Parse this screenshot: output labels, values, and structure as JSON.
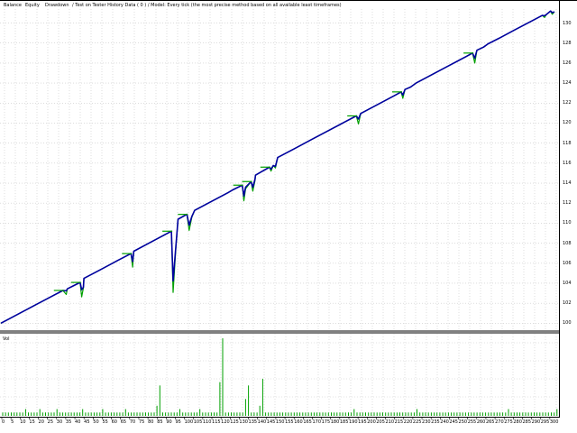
{
  "header": {
    "caption_parts": [
      "Balance",
      "Equity",
      "Drawdown"
    ],
    "caption_colors": [
      "#0000c0",
      "#00a000",
      "#000000"
    ],
    "caption_rest": "/ Test on Tester History Data ( 0 ) / Model: Every tick (the most precise method based on all available least timeframes)"
  },
  "volume": {
    "label": "Vol"
  },
  "chart_data": [
    {
      "type": "line",
      "title": "",
      "xlabel": "",
      "ylabel": "",
      "x": [
        0,
        3,
        6,
        9,
        11.2,
        11.8,
        12,
        13,
        14.3,
        14.6,
        14.9,
        15,
        18,
        21,
        23.5,
        23.8,
        24,
        27,
        30.8,
        31.1,
        31.6,
        32,
        33.6,
        34,
        34.5,
        35,
        38,
        41,
        42,
        43.6,
        43.9,
        44.2,
        45.2,
        45.5,
        45.9,
        46,
        47,
        47.9,
        48.5,
        48.8,
        49.2,
        49.6,
        50,
        53,
        56,
        59,
        62,
        64.2,
        64.6,
        65,
        68,
        71,
        72.3,
        72.6,
        73,
        74,
        75,
        78,
        81,
        84,
        85.2,
        85.6,
        86,
        87.2,
        88,
        90,
        93,
        96,
        97.8,
        98.2,
        98.6,
        99.3,
        99.6,
        100
      ],
      "series": [
        {
          "name": "Balance",
          "color": "#0000a0",
          "values": [
            1000,
            1022,
            1044,
            1066,
            1082,
            1081,
            1086,
            1093,
            1102,
            1084,
            1090,
            1112,
            1134,
            1156,
            1174,
            1154,
            1180,
            1202,
            1230,
            1106,
            1190,
            1260,
            1272,
            1245,
            1267,
            1282,
            1304,
            1326,
            1334,
            1345,
            1318,
            1340,
            1354,
            1340,
            1359,
            1370,
            1378,
            1385,
            1390,
            1385,
            1394,
            1392,
            1414,
            1436,
            1458,
            1480,
            1502,
            1518,
            1510,
            1524,
            1546,
            1568,
            1578,
            1570,
            1584,
            1590,
            1600,
            1622,
            1644,
            1666,
            1675,
            1662,
            1682,
            1690,
            1698,
            1712,
            1734,
            1756,
            1769,
            1768,
            1772,
            1780,
            1776,
            1778
          ]
        },
        {
          "name": "Equity",
          "color": "#00a000",
          "values": [
            1000,
            1022,
            1044,
            1066,
            1082,
            1072,
            1086,
            1093,
            1102,
            1066,
            1088,
            1112,
            1134,
            1156,
            1174,
            1140,
            1180,
            1202,
            1230,
            1077,
            1186,
            1260,
            1272,
            1232,
            1265,
            1282,
            1304,
            1326,
            1334,
            1345,
            1306,
            1336,
            1354,
            1330,
            1356,
            1370,
            1378,
            1385,
            1390,
            1380,
            1394,
            1388,
            1414,
            1436,
            1458,
            1480,
            1502,
            1518,
            1498,
            1524,
            1546,
            1568,
            1578,
            1562,
            1584,
            1590,
            1600,
            1622,
            1644,
            1666,
            1675,
            1650,
            1682,
            1690,
            1698,
            1712,
            1734,
            1756,
            1769,
            1764,
            1772,
            1780,
            1772,
            1778
          ]
        }
      ],
      "ylim": [
        985,
        1785
      ],
      "yticks": [
        1000,
        1050,
        1100,
        1150,
        1200,
        1250,
        1300,
        1350,
        1400,
        1450,
        1500,
        1550,
        1600,
        1650,
        1700,
        1750
      ],
      "ytick_labels": [
        "100",
        "102",
        "104",
        "106",
        "108",
        "110",
        "112",
        "114",
        "116",
        "118",
        "120",
        "122",
        "124",
        "126",
        "128",
        "130"
      ],
      "grid": true
    },
    {
      "type": "bar",
      "title": "",
      "values": [
        1,
        1,
        1,
        1,
        1,
        1,
        1,
        1,
        2,
        1,
        1,
        1,
        1,
        2,
        1,
        1,
        1,
        1,
        1,
        2,
        1,
        1,
        1,
        1,
        1,
        1,
        1,
        1,
        2,
        1,
        1,
        1,
        1,
        1,
        1,
        2,
        1,
        1,
        1,
        1,
        1,
        1,
        1,
        2,
        1,
        1,
        1,
        1,
        1,
        1,
        1,
        1,
        1,
        1,
        3,
        9,
        1,
        1,
        1,
        1,
        1,
        1,
        2,
        1,
        1,
        1,
        1,
        1,
        1,
        2,
        1,
        1,
        1,
        1,
        1,
        1,
        10,
        23,
        1,
        1,
        1,
        1,
        1,
        1,
        1,
        5,
        9,
        1,
        1,
        1,
        3,
        11,
        1,
        1,
        1,
        1,
        1,
        1,
        1,
        1,
        1,
        1,
        1,
        1,
        1,
        1,
        1,
        1,
        1,
        1,
        1,
        1,
        1,
        1,
        1,
        1,
        1,
        1,
        1,
        1,
        1,
        1,
        1,
        2,
        1,
        1,
        1,
        1,
        1,
        1,
        1,
        1,
        1,
        1,
        1,
        1,
        1,
        1,
        1,
        1,
        1,
        1,
        1,
        1,
        1,
        2,
        1,
        1,
        1,
        1,
        1,
        1,
        1,
        1,
        1,
        1,
        1,
        1,
        1,
        1,
        1,
        1,
        1,
        1,
        1,
        1,
        1,
        1,
        1,
        1,
        1,
        1,
        1,
        1,
        1,
        1,
        1,
        2,
        1,
        1,
        1,
        1,
        1,
        1,
        1,
        1,
        1,
        1,
        1,
        1,
        1,
        1,
        1,
        1,
        2
      ],
      "ylim": [
        0,
        23
      ],
      "color": "#00a000",
      "xtick_labels": [
        "0",
        "5",
        "10",
        "15",
        "20",
        "25",
        "30",
        "35",
        "40",
        "45",
        "50",
        "55",
        "60",
        "65",
        "70",
        "75",
        "80",
        "85",
        "90",
        "95",
        "100",
        "105",
        "110",
        "115",
        "120",
        "125",
        "130",
        "135",
        "140",
        "145",
        "150",
        "155",
        "160",
        "165",
        "170",
        "175",
        "180",
        "185",
        "190",
        "195",
        "200",
        "205",
        "210",
        "215",
        "220",
        "225",
        "230",
        "235",
        "240",
        "245",
        "250",
        "255",
        "260",
        "265",
        "270",
        "275",
        "280",
        "285",
        "290",
        "295",
        "300"
      ],
      "grid": true
    }
  ]
}
